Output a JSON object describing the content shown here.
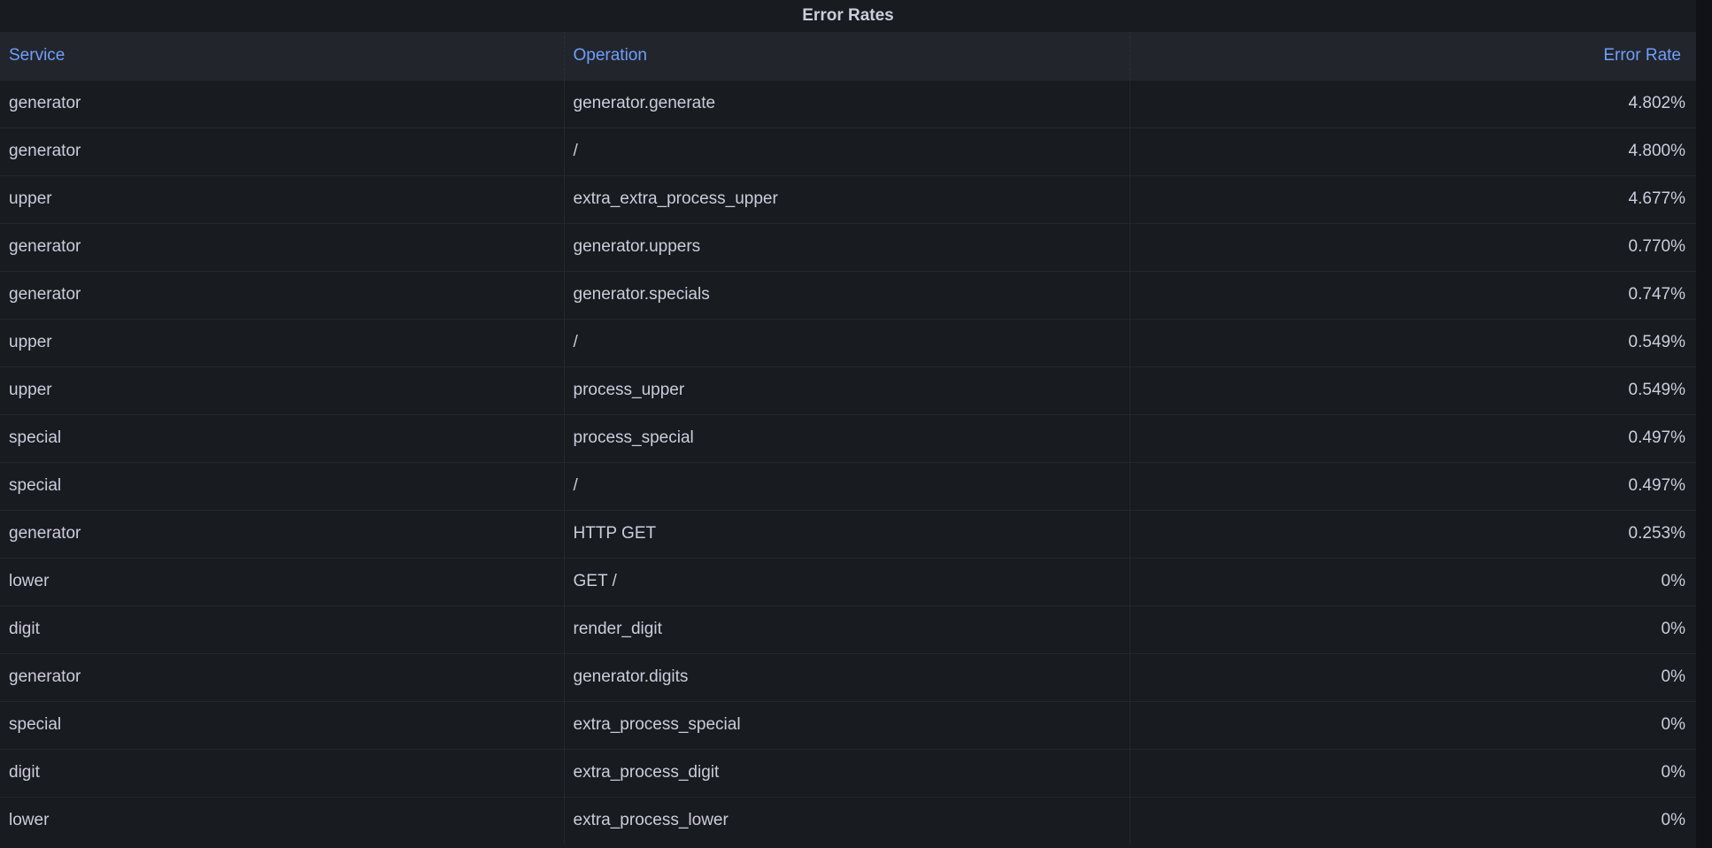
{
  "panel": {
    "title": "Error Rates"
  },
  "table": {
    "columns": [
      "Service",
      "Operation",
      "Error Rate"
    ],
    "rows": [
      [
        "generator",
        "generator.generate",
        "4.802%"
      ],
      [
        "generator",
        "/",
        "4.800%"
      ],
      [
        "upper",
        "extra_extra_process_upper",
        "4.677%"
      ],
      [
        "generator",
        "generator.uppers",
        "0.770%"
      ],
      [
        "generator",
        "generator.specials",
        "0.747%"
      ],
      [
        "upper",
        "/",
        "0.549%"
      ],
      [
        "upper",
        "process_upper",
        "0.549%"
      ],
      [
        "special",
        "process_special",
        "0.497%"
      ],
      [
        "special",
        "/",
        "0.497%"
      ],
      [
        "generator",
        "HTTP GET",
        "0.253%"
      ],
      [
        "lower",
        "GET /",
        "0%"
      ],
      [
        "digit",
        "render_digit",
        "0%"
      ],
      [
        "generator",
        "generator.digits",
        "0%"
      ],
      [
        "special",
        "extra_process_special",
        "0%"
      ],
      [
        "digit",
        "extra_process_digit",
        "0%"
      ],
      [
        "lower",
        "extra_process_lower",
        "0%"
      ]
    ]
  },
  "colors": {
    "background": "#181b1f",
    "header_background": "#22252b",
    "header_text": "#6e9fff",
    "cell_text": "#ccccdc"
  }
}
